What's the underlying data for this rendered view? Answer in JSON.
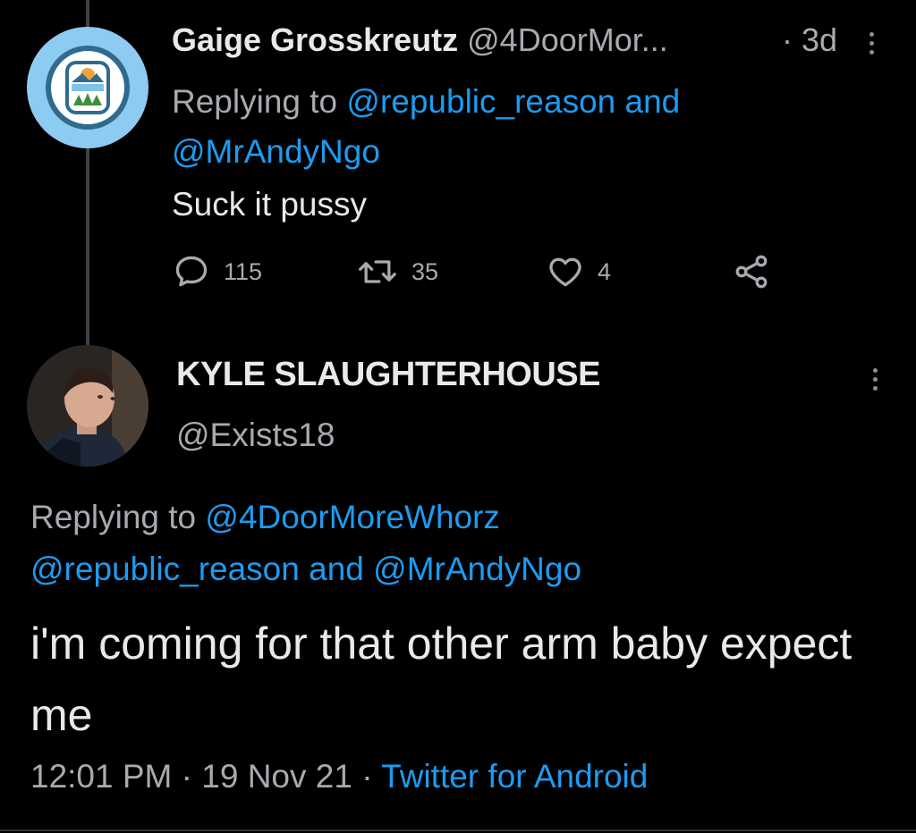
{
  "tweet1": {
    "display_name": "Gaige Grosskreutz",
    "handle": "@4DoorMor...",
    "time": "· 3d",
    "replying_prefix": "Replying to",
    "replying_mention_1": "@republic_reason",
    "replying_and": "and",
    "replying_mention_2": "@MrAndyNgo",
    "text": "Suck it pussy",
    "replies": "115",
    "retweets": "35",
    "likes": "4"
  },
  "tweet2": {
    "display_name": "KYLE SLAUGHTERHOUSE",
    "handle": "@Exists18",
    "replying_prefix": "Replying to",
    "replying_mention_1": "@4DoorMoreWhorz",
    "replying_mention_2": "@republic_reason",
    "replying_and": "and",
    "replying_mention_3": "@MrAndyNgo",
    "text": "i'm coming for that other arm baby expect me",
    "time": "12:01 PM",
    "date": "19 Nov 21",
    "source": "Twitter for Android"
  },
  "icons": {
    "reply": "speech-bubble-icon",
    "retweet": "retweet-icon",
    "like": "heart-icon",
    "share": "share-icon",
    "more": "more-vertical-icon"
  },
  "colors": {
    "background": "#000000",
    "primary_text": "#e7e9ea",
    "secondary_text": "#a7abaf",
    "link": "#1d9bf0",
    "avatar_bg": "#8ecbf0"
  }
}
